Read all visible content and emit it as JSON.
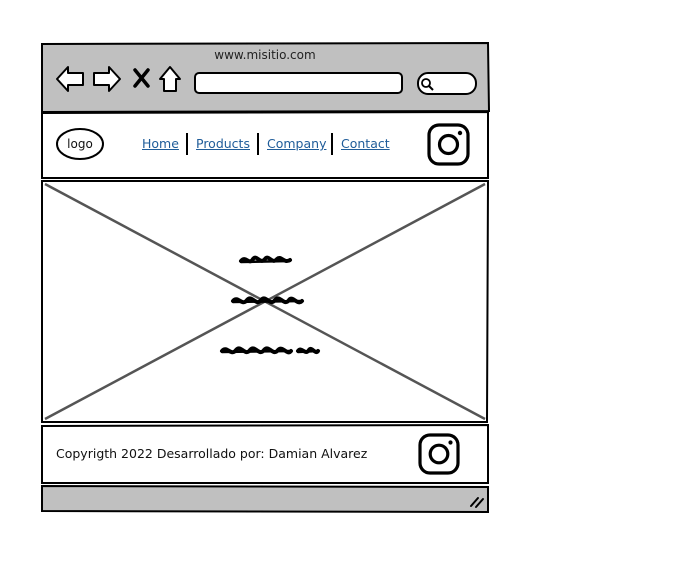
{
  "browser": {
    "url": "www.misitio.com",
    "back_icon": "arrow-left-icon",
    "forward_icon": "arrow-right-icon",
    "close_icon": "close-icon",
    "home_icon": "home-icon",
    "search_icon": "search-icon"
  },
  "header": {
    "logo_label": "logo",
    "nav": [
      {
        "label": "Home"
      },
      {
        "label": "Products"
      },
      {
        "label": "Company"
      },
      {
        "label": "Contact"
      }
    ],
    "social_icon": "instagram-icon"
  },
  "hero": {
    "placeholder_icon": "image-placeholder-icon",
    "scribble_lines": 3
  },
  "footer": {
    "text": "Copyrigth 2022 Desarrollado por: Damian Alvarez",
    "social_icon": "instagram-icon"
  },
  "colors": {
    "chrome": "#c0c0c0",
    "stroke": "#000000",
    "link": "#1f5c99",
    "placeholder_line": "#555555"
  }
}
